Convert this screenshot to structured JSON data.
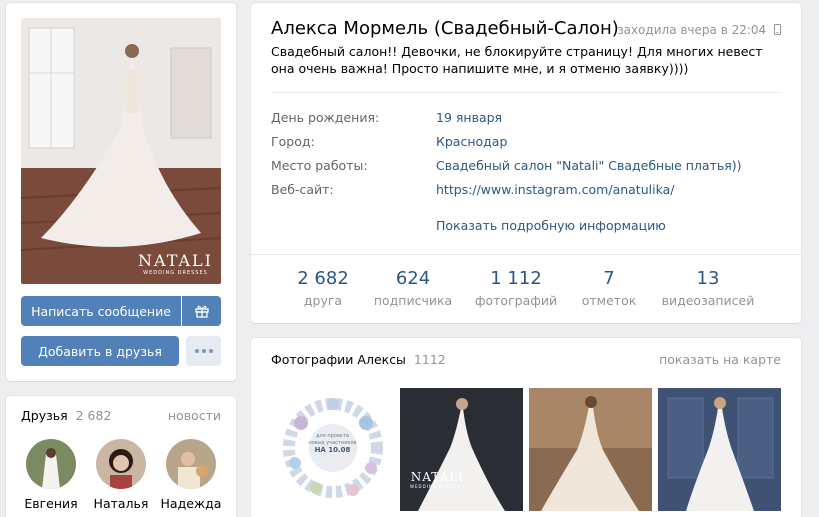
{
  "profile": {
    "name": "Алекса Мормель (Свадебный-Салон)",
    "last_seen": "заходила вчера в 22:04",
    "status": "Свадебный салон!! Девочки, не блокируйте страницу! Для многих невест она очень важна! Просто напишите мне, и я отменю заявку))))",
    "brand_logo": "NATALI",
    "brand_sub": "WEDDING DRESSES",
    "info": [
      {
        "label": "День рождения:",
        "value": "19 января"
      },
      {
        "label": "Город:",
        "value": "Краснодар"
      },
      {
        "label": "Место работы:",
        "value": "Свадебный салон \"Natali\" Свадебные платья))"
      },
      {
        "label": "Веб-сайт:",
        "value": "https://www.instagram.com/anatulika/"
      }
    ],
    "show_more": "Показать подробную информацию",
    "counters": [
      {
        "num": "2 682",
        "label": "друга"
      },
      {
        "num": "624",
        "label": "подписчика"
      },
      {
        "num": "1 112",
        "label": "фотографий"
      },
      {
        "num": "7",
        "label": "отметок"
      },
      {
        "num": "13",
        "label": "видеозаписей"
      }
    ]
  },
  "actions": {
    "message": "Написать сообщение",
    "add_friend": "Добавить в друзья"
  },
  "photos": {
    "title": "Фотографии Алексы",
    "count": "1112",
    "map_link": "показать на карте",
    "promo_line1": "для проекта",
    "promo_line2": "новых участников",
    "promo_date": "НА 10.08"
  },
  "friends": {
    "title": "Друзья",
    "count": "2 682",
    "news_link": "новости",
    "items": [
      {
        "name": "Евгения"
      },
      {
        "name": "Наталья"
      },
      {
        "name": "Надежда"
      }
    ]
  },
  "colors": {
    "link": "#2a5885",
    "button": "#5181b8",
    "background": "#edeef0"
  }
}
